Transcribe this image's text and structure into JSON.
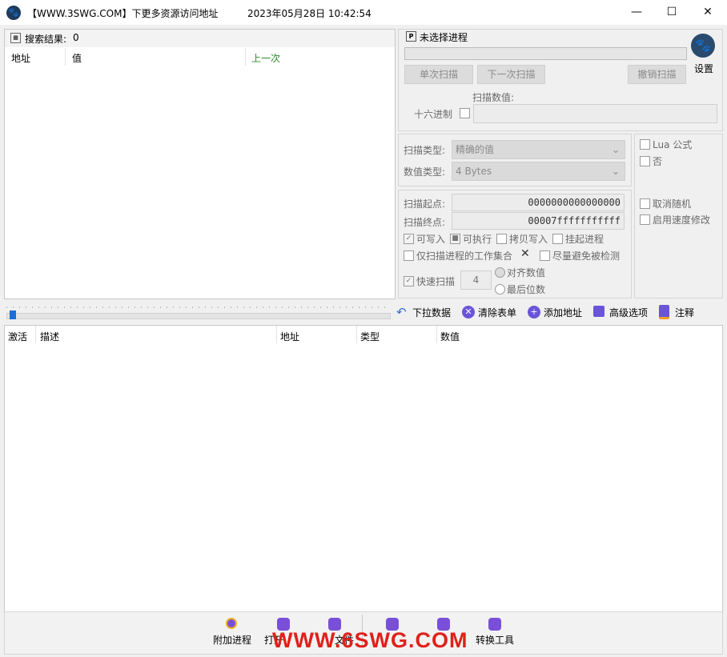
{
  "window": {
    "title": "【WWW.3SWG.COM】下更多资源访问地址",
    "datetime": "2023年05月28日 10:42:54",
    "minimize": "—",
    "maximize": "☐",
    "close": "✕"
  },
  "results": {
    "label": "搜索结果:",
    "count": "0",
    "columns": [
      "地址",
      "值",
      "上一次"
    ]
  },
  "scan": {
    "process_label": "未选择进程",
    "first_scan": "单次扫描",
    "next_scan": "下一次扫描",
    "undo_scan": "撤销扫描",
    "settings": "设置",
    "scan_value_label": "扫描数值:",
    "hex_label": "十六进制",
    "scan_type_label": "扫描类型:",
    "scan_type_value": "精确的值",
    "value_type_label": "数值类型:",
    "value_type_value": "4 Bytes",
    "lua_label": "Lua 公式",
    "not_label": "否",
    "start_label": "扫描起点:",
    "start_value": "0000000000000000",
    "end_label": "扫描终点:",
    "end_value": "00007fffffffffff",
    "writable": "可写入",
    "executable": "可执行",
    "copy_on_write": "拷贝写入",
    "suspend": "挂起进程",
    "working_set": "仅扫描进程的工作集合",
    "clear_x": "✕",
    "avoid_detect": "尽量避免被检测",
    "fast_scan": "快速扫描",
    "fast_scan_value": "4",
    "align": "对齐数值",
    "last_digits": "最后位数",
    "unrandomizer": "取消随机",
    "speedhack": "启用速度修改"
  },
  "toolbar": {
    "pull_data": "下拉数据",
    "clear_list": "清除表单",
    "add_address": "添加地址",
    "advanced": "高级选项",
    "comments": "注释"
  },
  "address_list": {
    "columns": [
      "激活",
      "描述",
      "地址",
      "类型",
      "数值"
    ]
  },
  "bottom": {
    "attach": "附加进程",
    "open": "打开",
    "file": "文件",
    "convert": "转换工具",
    "watermark": "WWW.6SWG.COM"
  },
  "colors": {
    "accent_blue": "#1a6ed8",
    "purple": "#6a55d8",
    "watermark_red": "#e0201a"
  }
}
